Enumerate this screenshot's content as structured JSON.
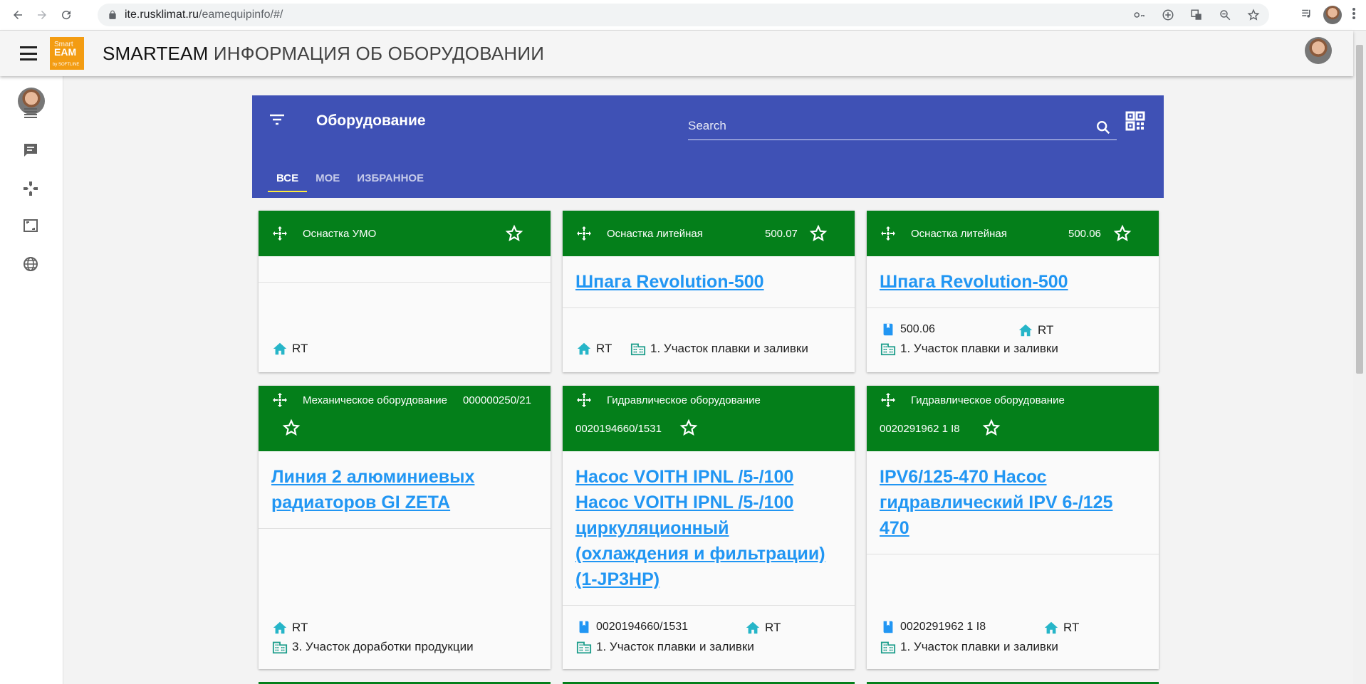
{
  "browser": {
    "url_host": "ite.rusklimat.ru",
    "url_path": "/eamequipinfo/#/"
  },
  "app": {
    "logo_line1": "Smart",
    "logo_line2": "EAM",
    "logo_line3": "by SOFTLINE",
    "title_brand": "SMARTEAM",
    "title_rest": " ИНФОРМАЦИЯ ОБ ОБОРУДОВАНИИ"
  },
  "toolbar": {
    "title": "Оборудование",
    "search_placeholder": "Search",
    "tabs": [
      {
        "label": "ВСЕ",
        "active": true
      },
      {
        "label": "МОЕ",
        "active": false
      },
      {
        "label": "ИЗБРАННОЕ",
        "active": false
      }
    ]
  },
  "cards": [
    {
      "category": "Оснастка УМО",
      "code": "",
      "title": "",
      "inv": "",
      "location": "RT",
      "area": ""
    },
    {
      "category": "Оснастка литейная",
      "code": "500.07",
      "title": "Шпага Revolution-500",
      "inv": "",
      "location": "RT",
      "area": "1. Участок плавки и заливки"
    },
    {
      "category": "Оснастка литейная",
      "code": "500.06",
      "title": "Шпага Revolution-500",
      "inv": "500.06",
      "location": "RT",
      "area": "1. Участок плавки и заливки"
    },
    {
      "category": "Механическое оборудование",
      "code": "000000250/21",
      "title_lines": [
        "Линия 2 алюминиевых",
        "радиаторов GI ZETA"
      ],
      "inv": "",
      "location": "RT",
      "area": "3. Участок доработки продукции"
    },
    {
      "category": "Гидравлическое оборудование",
      "code": "0020194660/1531",
      "title_lines": [
        "Насос VOITH IPNL /5-/100",
        "Насос VOITH IPNL /5-/100",
        "циркуляционный",
        "(охлаждения и фильтрации)",
        "(1-JP3HP)"
      ],
      "inv": "0020194660/1531",
      "location": "RT",
      "area": "1. Участок плавки и заливки"
    },
    {
      "category": "Гидравлическое оборудование",
      "code": "0020291962 1 I8",
      "title_lines": [
        "IPV6/125-470 Насос",
        "гидравлический IPV 6-/125",
        "470"
      ],
      "inv": "0020291962 1 I8",
      "location": "RT",
      "area": "1. Участок плавки и заливки"
    }
  ],
  "colors": {
    "toolbar": "#3f51b5",
    "card_header": "#047f1a",
    "link": "#2196f3",
    "home_icon": "#26b5c8",
    "area_icon": "#1e9e8c",
    "inv_icon": "#2196f3"
  },
  "icons": [
    "back-icon",
    "forward-icon",
    "reload-icon",
    "lock-icon",
    "key-icon",
    "add-icon",
    "translate-icon",
    "zoom-icon",
    "star-icon",
    "media-icon",
    "menu-dots-icon",
    "hamburger-icon",
    "list-icon",
    "comment-icon",
    "gamepad-icon",
    "expand-icon",
    "globe-icon",
    "filter-icon",
    "search-icon",
    "qr-code-icon",
    "move-icon",
    "home-icon",
    "building-icon",
    "book-icon"
  ]
}
